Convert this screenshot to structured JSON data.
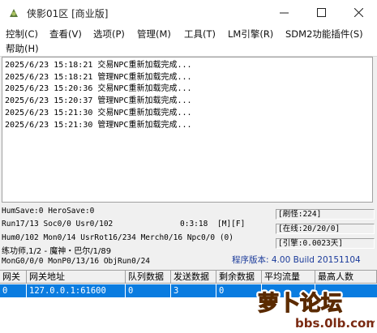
{
  "window": {
    "title": "侠影01区 [商业版]"
  },
  "menu": {
    "items": [
      "控制(C)",
      "查看(V)",
      "选项(P)",
      "管理(M)",
      "工具(T)",
      "LM引擎(R)",
      "SDM2功能插件(S)",
      "帮助(H)"
    ]
  },
  "log": {
    "lines": [
      "2025/6/23 15:18:21 交易NPC重新加载完成...",
      "2025/6/23 15:18:21 管理NPC重新加载完成...",
      "2025/6/23 15:20:36 交易NPC重新加载完成...",
      "2025/6/23 15:20:37 管理NPC重新加载完成...",
      "2025/6/23 15:21:30 交易NPC重新加载完成...",
      "2025/6/23 15:21:30 管理NPC重新加载完成..."
    ]
  },
  "status": {
    "save": "HumSave:0 HeroSave:0",
    "run": "Run17/13 Soc0/0 Usr0/102",
    "time": "0:3:18",
    "flags": "[M][F]",
    "hum": "Hum0/102 Mon0/14 UsrRot16/234 Merch0/16 Npc0/0 (0)",
    "char": "练功师,1/2 - 魔神・巴尔/1/89",
    "mon": "MonG0/0/0 MonP0/13/16 ObjRun0/24",
    "refresh": "[刷怪:224]",
    "online": "[在线:20/20/0]",
    "engine": "[引擎:0.0023天]",
    "version": "程序版本: 4.00 Build 20151104"
  },
  "table": {
    "headers": [
      "网关",
      "网关地址",
      "队列数据",
      "发送数据",
      "剩余数据",
      "平均流量",
      "最高人数"
    ],
    "row": [
      "0",
      "127.0.0.1:61600",
      "0",
      "3",
      "0",
      "",
      ""
    ]
  },
  "watermark": {
    "brand": "萝卜论坛",
    "url": "bbs.0lb.com"
  },
  "colors": {
    "selection": "#0a7ce0",
    "version_text": "#1a3a9a"
  }
}
